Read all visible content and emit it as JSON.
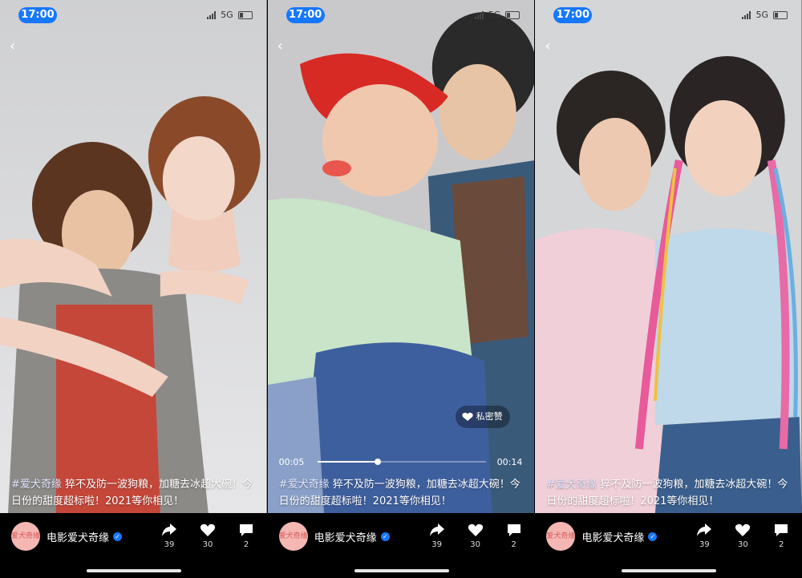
{
  "screens": [
    {
      "status": {
        "time": "17:00",
        "network": "5G"
      },
      "caption_tag": "#爱犬奇缘",
      "caption_text": " 猝不及防一波狗粮，加糖去冰超大碗！今日份的甜度超标啦！2021等你相见！",
      "account_name": "电影爱犬奇缘",
      "avatar_text": "爱犬奇缘",
      "share_count": "39",
      "like_count": "30",
      "comment_count": "2"
    },
    {
      "status": {
        "time": "17:00",
        "network": "5G"
      },
      "caption_tag": "#爱犬奇缘",
      "caption_text": " 猝不及防一波狗粮，加糖去冰超大碗！今日份的甜度超标啦！2021等你相见！",
      "account_name": "电影爱犬奇缘",
      "avatar_text": "爱犬奇缘",
      "share_count": "39",
      "like_count": "30",
      "comment_count": "2",
      "player": {
        "elapsed": "00:05",
        "duration": "00:14",
        "progress": 0.36
      },
      "private_like_label": "私密赞"
    },
    {
      "status": {
        "time": "17:00",
        "network": "5G"
      },
      "caption_tag": "#爱犬奇缘",
      "caption_text": " 猝不及防一波狗粮，加糖去冰超大碗！今日份的甜度超标啦！2021等你相见！",
      "account_name": "电影爱犬奇缘",
      "avatar_text": "爱犬奇缘",
      "share_count": "39",
      "like_count": "30",
      "comment_count": "2"
    }
  ],
  "icons": {
    "back": "chevron-left-icon",
    "share": "share-arrow-icon",
    "like": "heart-icon",
    "comment": "comment-bubble-icon",
    "verified": "verified-badge-icon",
    "private_like": "heart-lock-icon"
  },
  "colors": {
    "accent": "#1677ff",
    "bar_bg": "#000000",
    "avatar_bg": "#f4b7b4"
  }
}
